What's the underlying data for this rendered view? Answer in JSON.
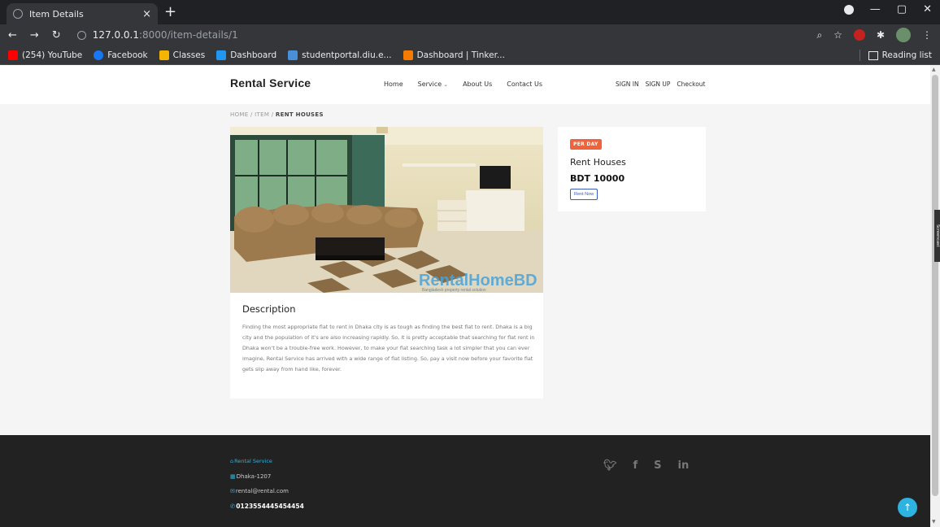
{
  "browser": {
    "tab_title": "Item Details",
    "tab_close": "×",
    "new_tab": "+",
    "url_host": "127.0.0.1",
    "url_path": ":8000/item-details/1",
    "bookmarks": [
      {
        "label": "(254) YouTube",
        "color": "#ff0000"
      },
      {
        "label": "Facebook",
        "color": "#1877f2"
      },
      {
        "label": "Classes",
        "color": "#f4b400"
      },
      {
        "label": "Dashboard",
        "color": "#2196f3"
      },
      {
        "label": "studentportal.diu.e...",
        "color": "#4a90d9"
      },
      {
        "label": "Dashboard | Tinker...",
        "color": "#f57c00"
      }
    ],
    "reading_list": "Reading list"
  },
  "site": {
    "brand": "Rental Service",
    "nav": [
      "Home",
      "Service",
      "About Us",
      "Contact Us"
    ],
    "auth": [
      "SIGN IN",
      "SIGN UP",
      "Checkout"
    ]
  },
  "breadcrumb": {
    "home": "HOME",
    "sep": "/",
    "item": "ITEM",
    "current": "RENT HOUSES"
  },
  "item": {
    "watermark": "RentalHomeBD",
    "watermark_sub": "Bangladesh property rental solution",
    "description_title": "Description",
    "description": "Finding the most appropriate flat to rent in Dhaka city is as tough as finding the best flat to rent. Dhaka is a big city and the population of it's are also increasing rapidly. So, it is pretty acceptable that searching for flat rent in Dhaka won't be a trouble-free work. However, to make your flat searching task a lot simpler that you can ever imagine, Rental Service has arrived with a wide range of flat listing. So, pay a visit now before your favorite flat gets slip away from hand like, forever.",
    "badge": "PER DAY",
    "name": "Rent Houses",
    "price": "BDT 10000",
    "rent_button": "Rent Now"
  },
  "footer": {
    "brand": "Rental Service",
    "address": "Dhaka-1207",
    "email": "rental@rental.com",
    "phone": "0123554445454454",
    "social": [
      "twitter-icon",
      "facebook-icon",
      "skype-icon",
      "linkedin-icon"
    ]
  },
  "overlay": {
    "screencast": "Screencast"
  },
  "colors": {
    "accent": "#2eb3e0",
    "badge": "#f0623a",
    "footer_bg": "#222222",
    "button": "#3b5bbf"
  }
}
